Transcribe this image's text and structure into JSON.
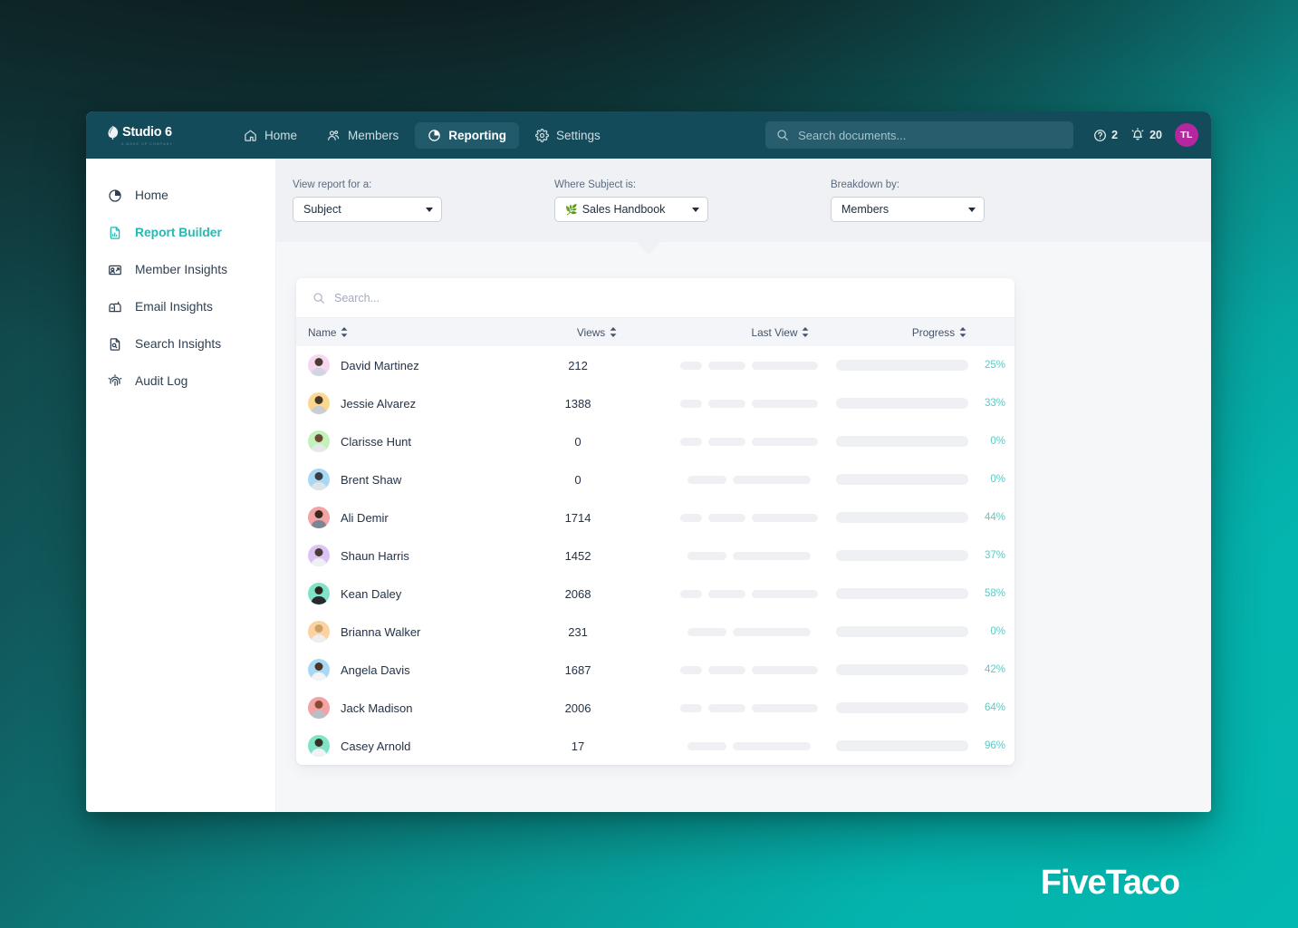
{
  "background": {
    "gradient_from": "#12393c",
    "gradient_to": "#03b8b0",
    "overlay": "#0c1616"
  },
  "navbar": {
    "logo": {
      "name": "Studio 6",
      "tagline": "A MAKE UP COMPANY"
    },
    "items": [
      {
        "label": "Home",
        "icon": "home-icon",
        "active": false
      },
      {
        "label": "Members",
        "icon": "members-icon",
        "active": false
      },
      {
        "label": "Reporting",
        "icon": "reporting-pie-icon",
        "active": true
      },
      {
        "label": "Settings",
        "icon": "gear-icon",
        "active": false
      }
    ],
    "search_placeholder": "Search documents...",
    "help_count": "2",
    "notification_count": "20",
    "avatar_initials": "TL",
    "avatar_color": "#b5279e",
    "bar_color": "#134b5b",
    "active_pill_color": "#215a6b"
  },
  "sidebar": {
    "items": [
      {
        "label": "Home",
        "icon": "pie-chart-icon",
        "active": false
      },
      {
        "label": "Report Builder",
        "icon": "report-doc-icon",
        "active": true
      },
      {
        "label": "Member Insights",
        "icon": "member-insights-icon",
        "active": false
      },
      {
        "label": "Email Insights",
        "icon": "mailbox-icon",
        "active": false
      },
      {
        "label": "Search Insights",
        "icon": "search-doc-icon",
        "active": false
      },
      {
        "label": "Audit Log",
        "icon": "fingerprint-icon",
        "active": false
      }
    ],
    "active_color": "#26b9b0"
  },
  "filters": [
    {
      "label": "View report for a:",
      "value": "Subject",
      "emoji": "",
      "width": "w165"
    },
    {
      "label": "Where Subject is:",
      "value": "Sales Handbook",
      "emoji": "🌿",
      "width": "w170"
    },
    {
      "label": "Breakdown by:",
      "value": "Members",
      "emoji": "",
      "width": "w170"
    }
  ],
  "table": {
    "search_placeholder": "Search...",
    "columns": [
      {
        "label": "Name",
        "sortable": true
      },
      {
        "label": "Views",
        "sortable": true
      },
      {
        "label": "Last View",
        "sortable": true
      },
      {
        "label": "Progress",
        "sortable": true
      }
    ],
    "accent_color": "#5ec9c2",
    "rows": [
      {
        "name": "David Martinez",
        "views": "212",
        "progress": 25,
        "progress_label": "25%",
        "skeleton": "three",
        "avatar_bg": "#f6d7ef",
        "hair": "#4b3a2f",
        "shirt": "#cfd6dd"
      },
      {
        "name": "Jessie Alvarez",
        "views": "1388",
        "progress": 33,
        "progress_label": "33%",
        "skeleton": "three",
        "avatar_bg": "#fbd88f",
        "hair": "#4a372b",
        "shirt": "#c9ced4"
      },
      {
        "name": "Clarisse Hunt",
        "views": "0",
        "progress": 0,
        "progress_label": "0%",
        "skeleton": "three",
        "avatar_bg": "#c4f0b9",
        "hair": "#6b4a33",
        "shirt": "#e6e9ec"
      },
      {
        "name": "Brent Shaw",
        "views": "0",
        "progress": 0,
        "progress_label": "0%",
        "skeleton": "two",
        "avatar_bg": "#a9d9f2",
        "hair": "#3b3b44",
        "shirt": "#dfe4e8"
      },
      {
        "name": "Ali Demir",
        "views": "1714",
        "progress": 44,
        "progress_label": "44%",
        "skeleton": "three",
        "avatar_bg": "#f3a3a3",
        "hair": "#38281f",
        "shirt": "#7b8794"
      },
      {
        "name": "Shaun Harris",
        "views": "1452",
        "progress": 37,
        "progress_label": "37%",
        "skeleton": "two",
        "avatar_bg": "#dcc3f5",
        "hair": "#4b3b30",
        "shirt": "#eef0f2"
      },
      {
        "name": "Kean Daley",
        "views": "2068",
        "progress": 58,
        "progress_label": "58%",
        "skeleton": "three",
        "avatar_bg": "#7fe3c6",
        "hair": "#2c2620",
        "shirt": "#252a33"
      },
      {
        "name": "Brianna Walker",
        "views": "231",
        "progress": 0,
        "progress_label": "0%",
        "skeleton": "two",
        "avatar_bg": "#fbd2a0",
        "hair": "#caa26a",
        "shirt": "#eceef0"
      },
      {
        "name": "Angela Davis",
        "views": "1687",
        "progress": 42,
        "progress_label": "42%",
        "skeleton": "three",
        "avatar_bg": "#a9d9f2",
        "hair": "#4a3526",
        "shirt": "#f2f4f6"
      },
      {
        "name": "Jack Madison",
        "views": "2006",
        "progress": 64,
        "progress_label": "64%",
        "skeleton": "three",
        "avatar_bg": "#f3a3a3",
        "hair": "#8a4a2f",
        "shirt": "#b9bfc6"
      },
      {
        "name": "Casey Arnold",
        "views": "17",
        "progress": 96,
        "progress_label": "96%",
        "skeleton": "two",
        "avatar_bg": "#7fe3c6",
        "hair": "#3a2f26",
        "shirt": "#f0f2f4"
      }
    ]
  },
  "brand": {
    "name": "FiveTaco"
  }
}
